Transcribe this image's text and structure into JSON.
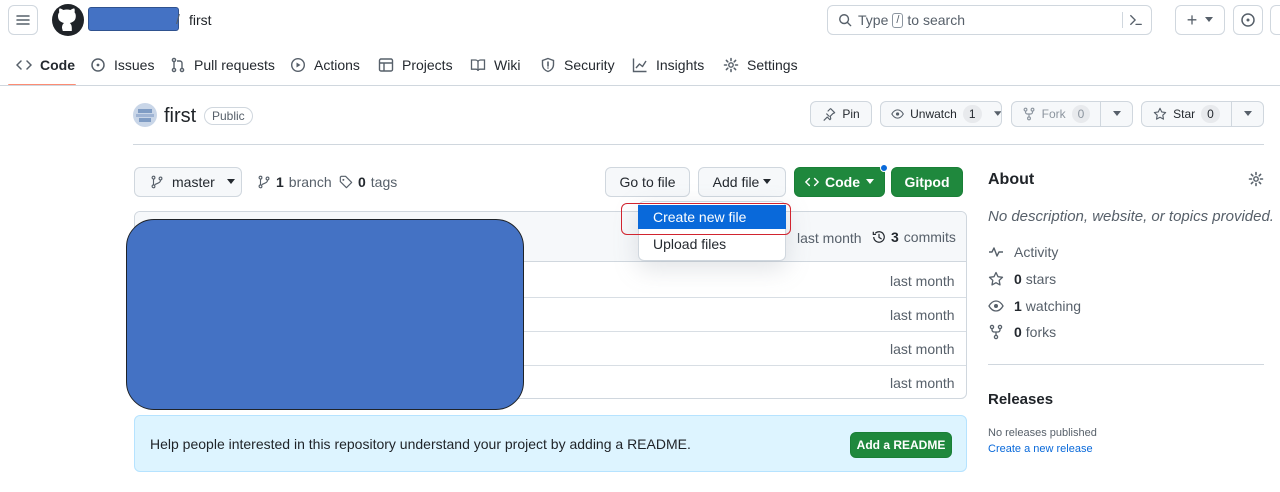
{
  "header": {
    "repo_name": "first",
    "search_placeholder_before": "Type",
    "search_key": "/",
    "search_placeholder_after": "to search",
    "plus_label": "+"
  },
  "tabs": [
    {
      "label": "Code"
    },
    {
      "label": "Issues"
    },
    {
      "label": "Pull requests"
    },
    {
      "label": "Actions"
    },
    {
      "label": "Projects"
    },
    {
      "label": "Wiki"
    },
    {
      "label": "Security"
    },
    {
      "label": "Insights"
    },
    {
      "label": "Settings"
    }
  ],
  "repo": {
    "title": "first",
    "visibility": "Public",
    "pin_label": "Pin",
    "unwatch_label": "Unwatch",
    "unwatch_count": "1",
    "fork_label": "Fork",
    "fork_count": "0",
    "star_label": "Star",
    "star_count": "0"
  },
  "toolbar": {
    "branch_name": "master",
    "branch_count": "1",
    "branch_label": "branch",
    "tag_count": "0",
    "tag_label": "tags",
    "go_to_file": "Go to file",
    "add_file": "Add file",
    "code": "Code",
    "gitpod": "Gitpod"
  },
  "dropdown": {
    "create_new_file": "Create new file",
    "upload_files": "Upload files"
  },
  "commit_bar": {
    "time": "last month",
    "commit_count": "3",
    "commit_label": "commits"
  },
  "files": [
    {
      "time": "last month"
    },
    {
      "time": "last month"
    },
    {
      "time": "last month"
    },
    {
      "time": "last month"
    }
  ],
  "readme_banner": {
    "text": "Help people interested in this repository understand your project by adding a README.",
    "button": "Add a README"
  },
  "about": {
    "heading": "About",
    "description": "No description, website, or topics provided.",
    "activity": "Activity",
    "stars_count": "0",
    "stars_label": "stars",
    "watching_count": "1",
    "watching_label": "watching",
    "forks_count": "0",
    "forks_label": "forks"
  },
  "releases": {
    "heading": "Releases",
    "none_text": "No releases published",
    "create_link": "Create a new release"
  },
  "colors": {
    "redaction_blue": "#4472c4",
    "primary_green": "#1f883d",
    "selected_blue": "#0969da",
    "highlight_red": "#d1242f",
    "tab_underline": "#fd8c73"
  }
}
